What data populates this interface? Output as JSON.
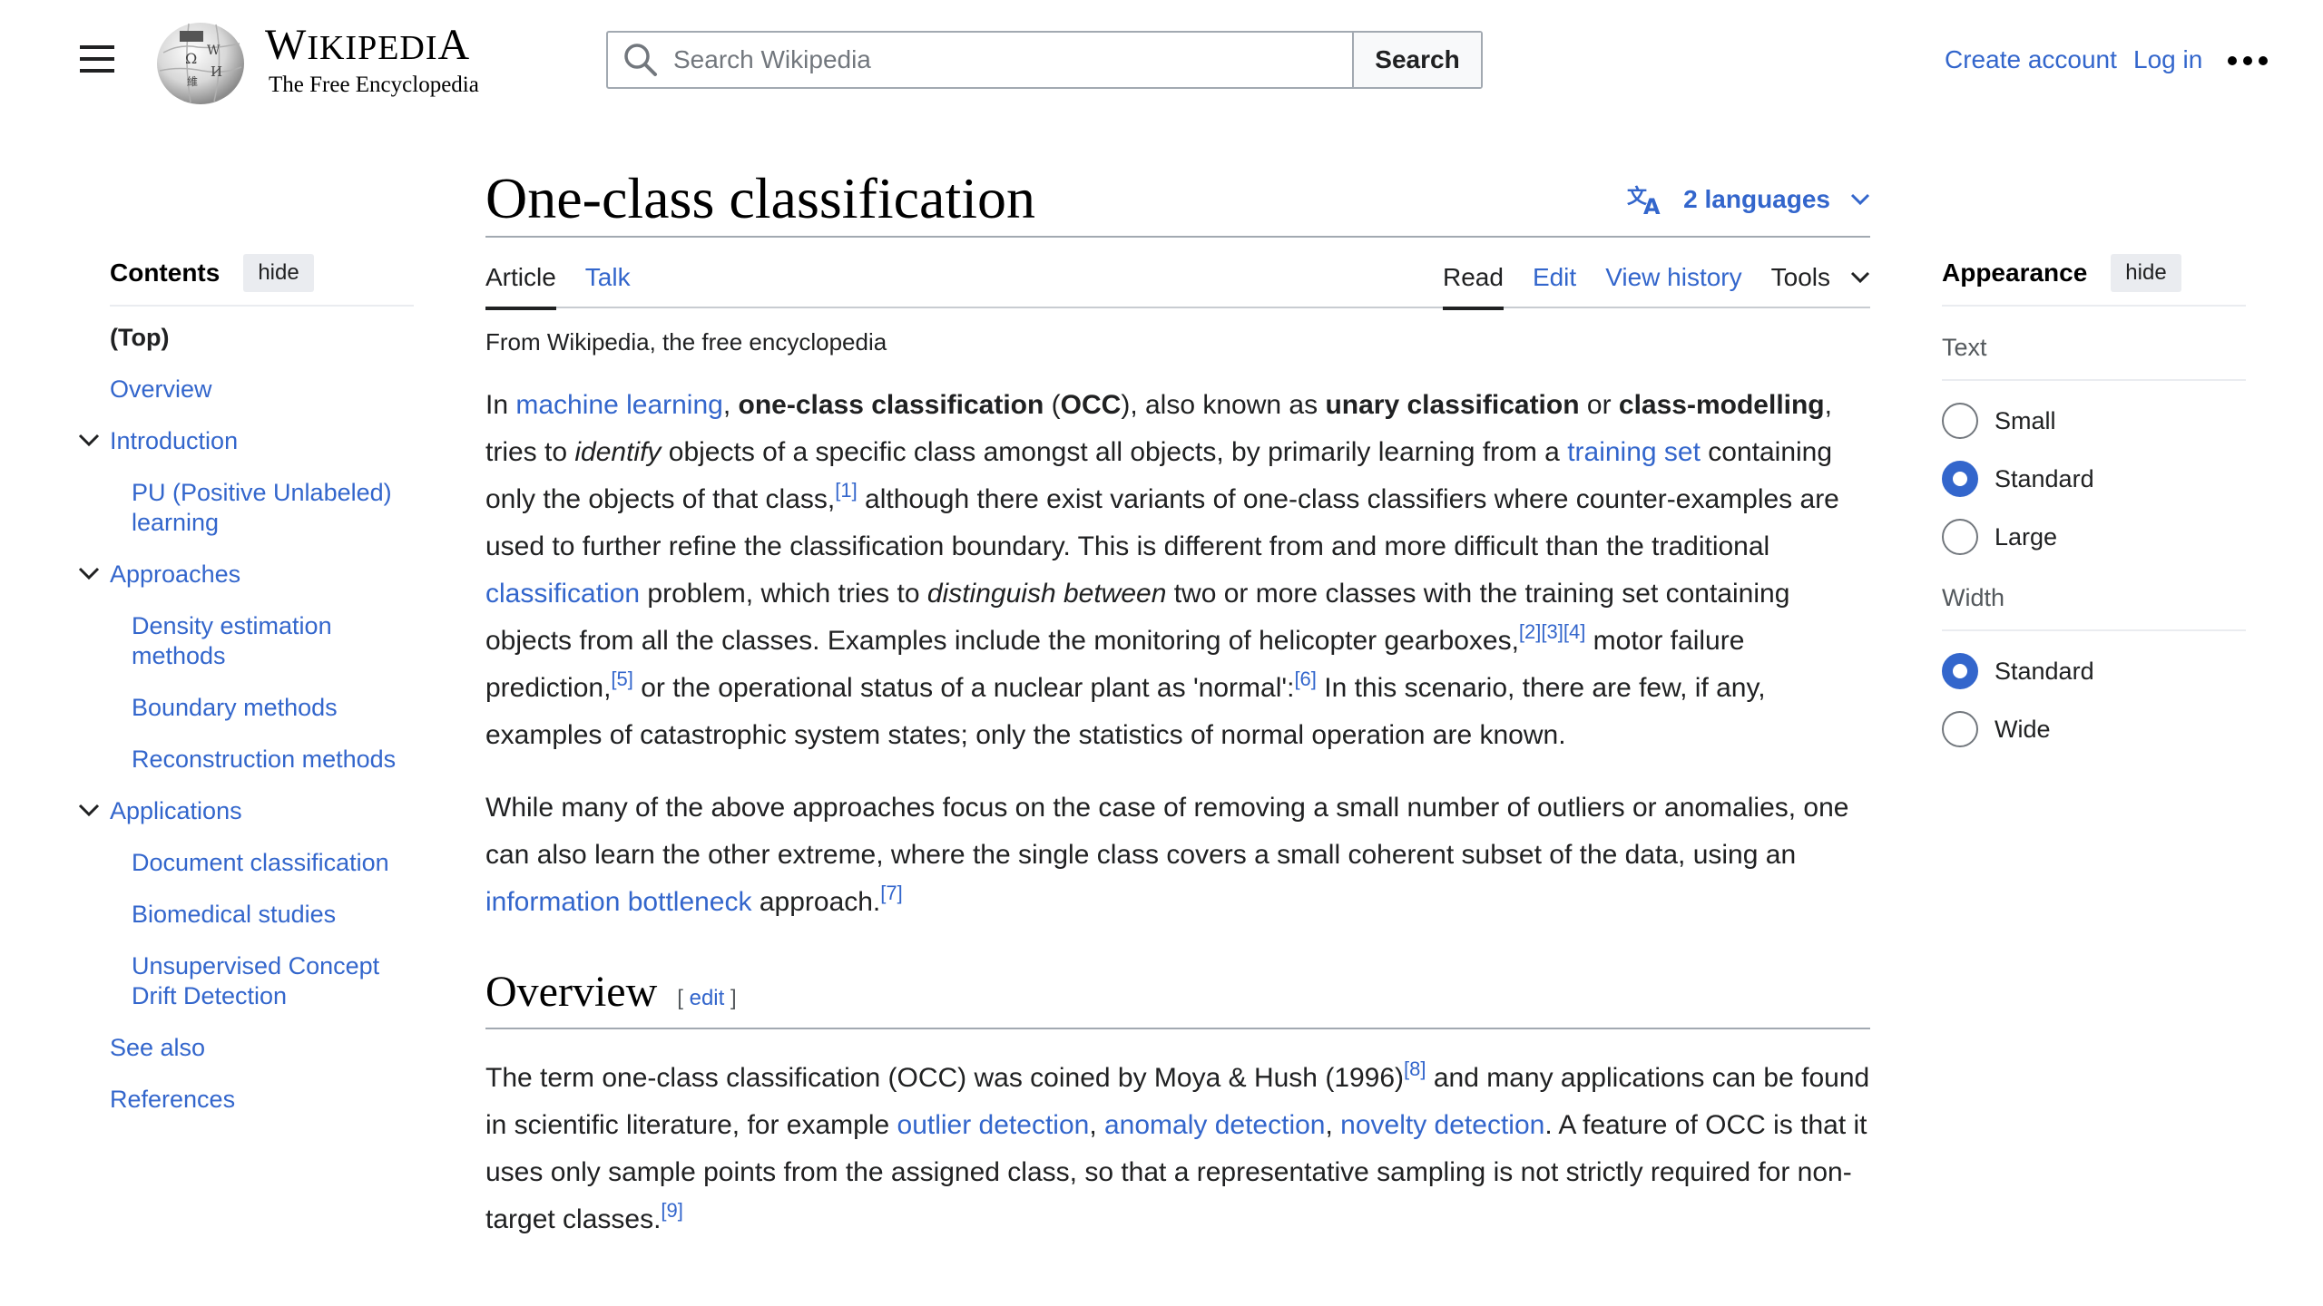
{
  "header": {
    "menu_icon": "hamburger-menu-icon",
    "logo_icon": "wikipedia-globe-logo",
    "wordmark_first": "W",
    "wordmark_small": "IKIPEDI",
    "wordmark_last": "A",
    "tagline": "The Free Encyclopedia",
    "search": {
      "placeholder": "Search Wikipedia",
      "value": "",
      "button_label": "Search",
      "icon": "search-icon"
    },
    "user_links": {
      "create_account": "Create account",
      "log_in": "Log in",
      "more_icon": "ellipsis-icon"
    }
  },
  "toc": {
    "title": "Contents",
    "hide_label": "hide",
    "items": [
      {
        "label": "(Top)",
        "level": 1,
        "current": true
      },
      {
        "label": "Overview",
        "level": 1
      },
      {
        "label": "Introduction",
        "level": 1,
        "expanded": true
      },
      {
        "label": "PU (Positive Unlabeled) learning",
        "level": 2
      },
      {
        "label": "Approaches",
        "level": 1,
        "expanded": true
      },
      {
        "label": "Density estimation methods",
        "level": 2
      },
      {
        "label": "Boundary methods",
        "level": 2
      },
      {
        "label": "Reconstruction methods",
        "level": 2
      },
      {
        "label": "Applications",
        "level": 1,
        "expanded": true
      },
      {
        "label": "Document classification",
        "level": 2
      },
      {
        "label": "Biomedical studies",
        "level": 2
      },
      {
        "label": "Unsupervised Concept Drift Detection",
        "level": 2
      },
      {
        "label": "See also",
        "level": 1
      },
      {
        "label": "References",
        "level": 1
      }
    ]
  },
  "article": {
    "title": "One-class classification",
    "languages_label": "2 languages",
    "tabs_left": [
      {
        "label": "Article",
        "active": true
      },
      {
        "label": "Talk",
        "active": false
      }
    ],
    "tabs_right": [
      {
        "label": "Read",
        "active": true
      },
      {
        "label": "Edit",
        "active": false
      },
      {
        "label": "View history",
        "active": false
      },
      {
        "label": "Tools",
        "active": false,
        "dropdown": true
      }
    ],
    "tagline": "From Wikipedia, the free encyclopedia",
    "p1": {
      "t1": "In ",
      "l_machine_learning": "machine learning",
      "t2": ", ",
      "b_occ": "one-class classification",
      "t3": " (",
      "b_occ_abbr": "OCC",
      "t4": "), also known as ",
      "b_unary": "unary classification",
      "t5": " or ",
      "b_class_modelling": "class-modelling",
      "t6": ", tries to ",
      "i_identify": "identify",
      "t7": " objects of a specific class amongst all objects, by primarily learning from a ",
      "l_training_set": "training set",
      "t8": " containing only the objects of that class,",
      "ref1": "[1]",
      "t9": " although there exist variants of one-class classifiers where counter-examples are used to further refine the classification boundary. This is different from and more difficult than the traditional ",
      "l_classification": "classification",
      "t10": " problem, which tries to ",
      "i_distinguish": "distinguish between",
      "t11": " two or more classes with the training set containing objects from all the classes. Examples include the monitoring of helicopter gearboxes,",
      "ref2": "[2]",
      "ref3": "[3]",
      "ref4": "[4]",
      "t12": " motor failure prediction,",
      "ref5": "[5]",
      "t13": " or the operational status of a nuclear plant as 'normal':",
      "ref6": "[6]",
      "t14": " In this scenario, there are few, if any, examples of catastrophic system states; only the statistics of normal operation are known."
    },
    "p2": {
      "t1": "While many of the above approaches focus on the case of removing a small number of outliers or anomalies, one can also learn the other extreme, where the single class covers a small coherent subset of the data, using an ",
      "l_info_bottleneck": "information bottleneck",
      "t2": " approach.",
      "ref7": "[7]"
    },
    "overview": {
      "heading": "Overview",
      "edit_open": "[ ",
      "edit_label": "edit",
      "edit_close": " ]",
      "p": {
        "t1": "The term one-class classification (OCC) was coined by Moya & Hush (1996)",
        "ref8": "[8]",
        "t2": " and many applications can be found in scientific literature, for example ",
        "l_outlier": "outlier detection",
        "t3": ", ",
        "l_anomaly": "anomaly detection",
        "t4": ", ",
        "l_novelty": "novelty detection",
        "t5": ". A feature of OCC is that it uses only sample points from the assigned class, so that a representative sampling is not strictly required for non-target classes.",
        "ref9": "[9]"
      }
    }
  },
  "appearance": {
    "title": "Appearance",
    "hide_label": "hide",
    "text_label": "Text",
    "text_options": [
      {
        "label": "Small",
        "checked": false
      },
      {
        "label": "Standard",
        "checked": true
      },
      {
        "label": "Large",
        "checked": false
      }
    ],
    "width_label": "Width",
    "width_options": [
      {
        "label": "Standard",
        "checked": true
      },
      {
        "label": "Wide",
        "checked": false
      }
    ]
  },
  "colors": {
    "link": "#3366cc",
    "text": "#202122",
    "border": "#a2a9b1",
    "button_bg": "#eaecf0",
    "radio_checked": "#3366cc"
  }
}
